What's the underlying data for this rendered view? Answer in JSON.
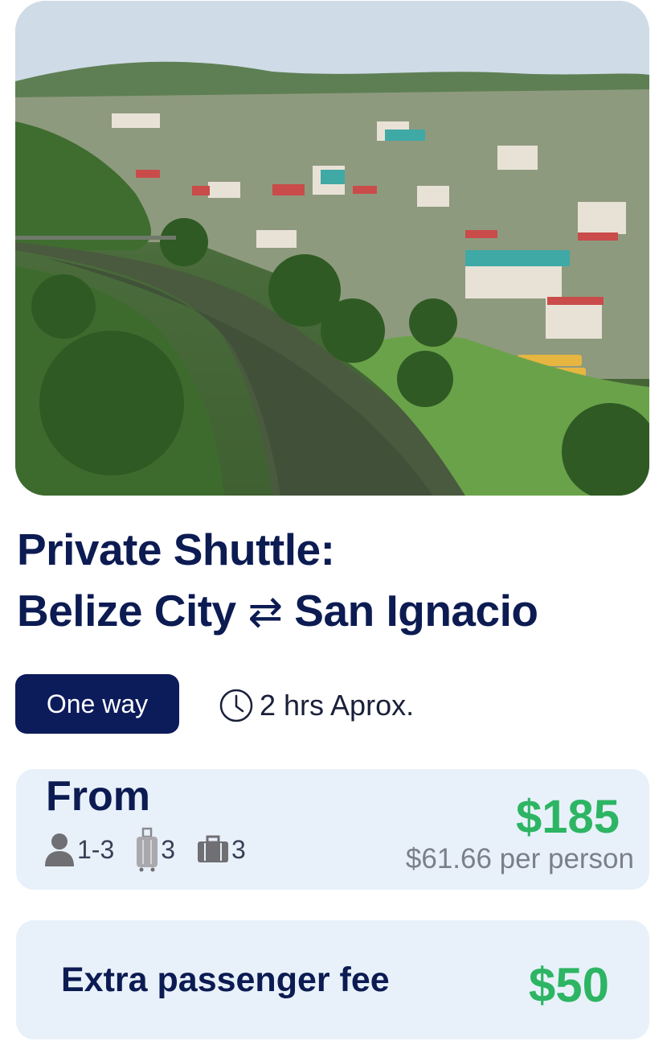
{
  "hero": {
    "alt": "Aerial view of San Ignacio town beside a river"
  },
  "title": {
    "line1": "Private Shuttle:",
    "origin": "Belize City",
    "arrow": "⇄",
    "destination": "San Ignacio"
  },
  "trip_type": {
    "label": "One way"
  },
  "duration": {
    "icon": "clock-icon",
    "text": "2 hrs  Aprox."
  },
  "pricing": {
    "from_label": "From",
    "capacity": {
      "passengers": {
        "icon": "person-icon",
        "value": "1-3"
      },
      "luggage": {
        "icon": "suitcase-icon",
        "value": "3"
      },
      "carry_on": {
        "icon": "briefcase-icon",
        "value": "3"
      }
    },
    "price": "$185",
    "per_person": "$61.66 per person"
  },
  "extra_fee": {
    "label": "Extra passenger fee",
    "price": "$50"
  },
  "colors": {
    "brand_navy": "#0c1b5a",
    "price_green": "#2db564",
    "card_bg": "#e8f1fa"
  }
}
